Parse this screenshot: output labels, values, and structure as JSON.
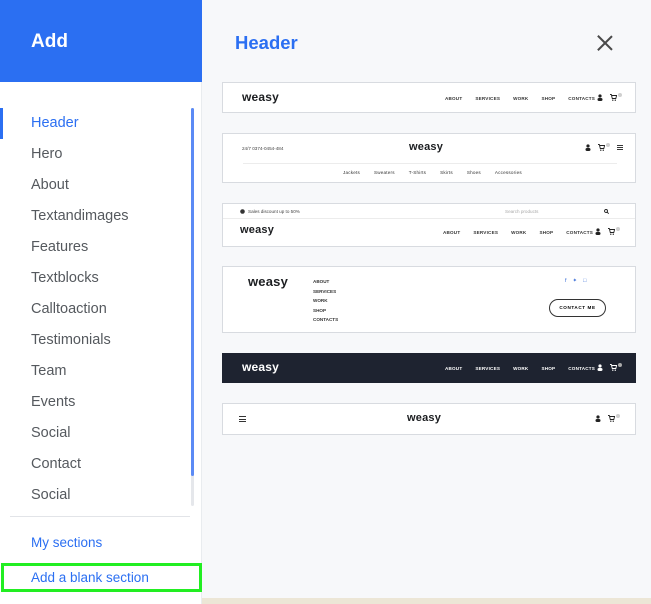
{
  "sidebar": {
    "title": "Add",
    "items": [
      {
        "label": "Header",
        "active": true
      },
      {
        "label": "Hero"
      },
      {
        "label": "About"
      },
      {
        "label": "Textandimages"
      },
      {
        "label": "Features"
      },
      {
        "label": "Textblocks"
      },
      {
        "label": "Calltoaction"
      },
      {
        "label": "Testimonials"
      },
      {
        "label": "Team"
      },
      {
        "label": "Events"
      },
      {
        "label": "Social"
      },
      {
        "label": "Contact"
      },
      {
        "label": "Social"
      }
    ],
    "my_sections": "My sections",
    "add_blank": "Add a blank section"
  },
  "main": {
    "title": "Header",
    "close_icon": "close-icon",
    "logo": "weasy",
    "nav": [
      "ABOUT",
      "SERVICES",
      "WORK",
      "SHOP",
      "CONTACTS"
    ],
    "variant2": {
      "phone": "24/7 0374-0454-484",
      "categories": [
        "Jackets",
        "Sweaters",
        "T-Shirts",
        "Skirts",
        "Shoes",
        "Accessories"
      ]
    },
    "variant3": {
      "promo": "Sales discount up to 50%",
      "search_placeholder": "Search products"
    },
    "variant4": {
      "contact_button": "CONTACT ME"
    }
  },
  "colors": {
    "accent": "#2b6ff2",
    "highlight": "#22ee22",
    "dark_header": "#1e2330"
  }
}
